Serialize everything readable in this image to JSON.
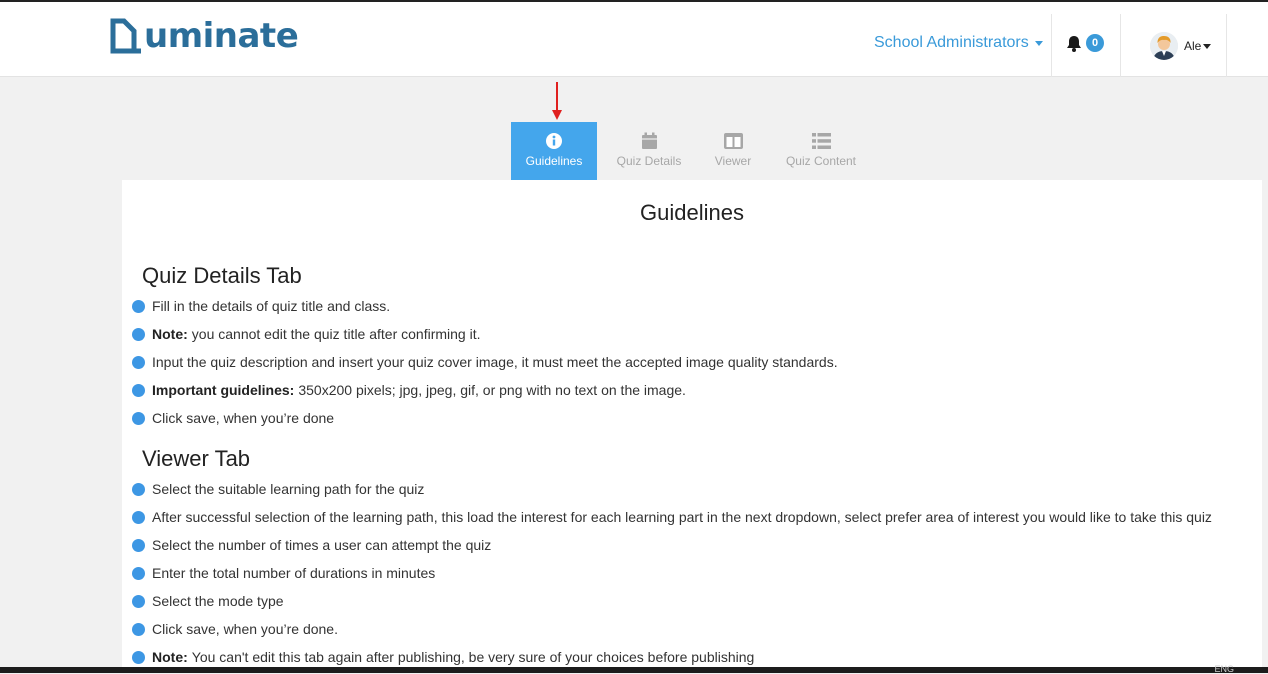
{
  "brand": {
    "logo_text": "uminate"
  },
  "header": {
    "role_menu_label": "School Administrators",
    "notification_count": "0",
    "user_name": "Ale"
  },
  "tabs": [
    {
      "label": "Guidelines",
      "icon": "info-circle-icon",
      "active": true
    },
    {
      "label": "Quiz Details",
      "icon": "calendar-icon",
      "active": false
    },
    {
      "label": "Viewer",
      "icon": "columns-icon",
      "active": false
    },
    {
      "label": "Quiz Content",
      "icon": "list-icon",
      "active": false
    }
  ],
  "page_title": "Guidelines",
  "sections": [
    {
      "title": "Quiz Details Tab",
      "items": [
        {
          "bold": "",
          "text": "Fill in the details of quiz title and class."
        },
        {
          "bold": "Note:",
          "text": "you cannot edit the quiz title after confirming it."
        },
        {
          "bold": "",
          "text": "Input the quiz description and insert your quiz cover image, it must meet the accepted image quality standards."
        },
        {
          "bold": "Important guidelines:",
          "text": "350x200 pixels; jpg, jpeg, gif, or png with no text on the image."
        },
        {
          "bold": "",
          "text": "Click save, when you’re done"
        }
      ]
    },
    {
      "title": "Viewer Tab",
      "items": [
        {
          "bold": "",
          "text": "Select the suitable learning path for the quiz"
        },
        {
          "bold": "",
          "text": "After successful selection of the learning path, this load the interest for each learning part in the next dropdown, select prefer area of interest you would like to take this quiz"
        },
        {
          "bold": "",
          "text": "Select the number of times a user can attempt the quiz"
        },
        {
          "bold": "",
          "text": "Enter the total number of durations in minutes"
        },
        {
          "bold": "",
          "text": "Select the mode type"
        },
        {
          "bold": "",
          "text": "Click save, when you’re done."
        },
        {
          "bold": "Note:",
          "text": "You can't edit this tab again after publishing, be very sure of your choices before publishing"
        }
      ]
    }
  ],
  "taskbar": {
    "language": "ENG"
  },
  "colors": {
    "accent": "#44a6ec",
    "brand": "#2b6e9a",
    "bullet": "#3d97e4",
    "arrow": "#e0201f"
  }
}
